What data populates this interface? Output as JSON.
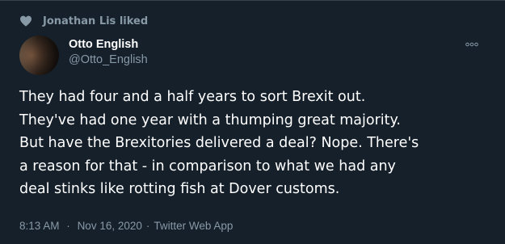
{
  "social_context": {
    "icon": "heart-icon",
    "text": "Jonathan Lis liked"
  },
  "author": {
    "display_name": "Otto English",
    "handle": "@Otto_English"
  },
  "tweet": {
    "lines": [
      "They had four and a half years to sort Brexit out.",
      "They've had one year with a thumping great majority.",
      "But have the Brexitories delivered a deal? Nope. There's",
      "a reason for that - in comparison to what we had any",
      "deal stinks like rotting fish at Dover customs."
    ]
  },
  "meta": {
    "time": "8:13 AM",
    "separator": "·",
    "date": "Nov 16, 2020",
    "source": "Twitter Web App"
  },
  "colors": {
    "background": "#15202b",
    "text": "#ffffff",
    "secondary": "#8899a6"
  }
}
